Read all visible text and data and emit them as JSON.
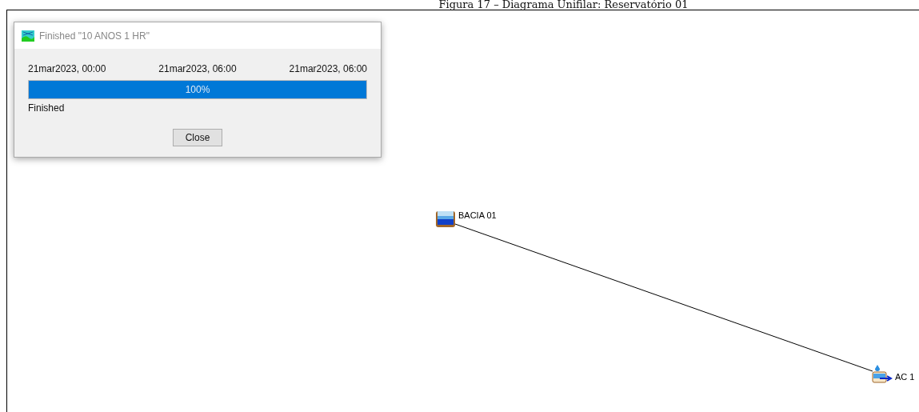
{
  "caption": "Figura 17 – Diagrama Unifilar: Reservatório 01",
  "dialog": {
    "title": "Finished \"10 ANOS 1 HR\"",
    "times": [
      "21mar2023, 00:00",
      "21mar2023, 06:00",
      "21mar2023, 06:00"
    ],
    "progress": {
      "level": 1,
      "label": "100%"
    },
    "status": "Finished",
    "button": "Close"
  },
  "diagram": {
    "nodes": [
      {
        "kind": "subbasin",
        "label": "BACIA 01"
      },
      {
        "kind": "junction",
        "label": "AC 1"
      }
    ]
  }
}
